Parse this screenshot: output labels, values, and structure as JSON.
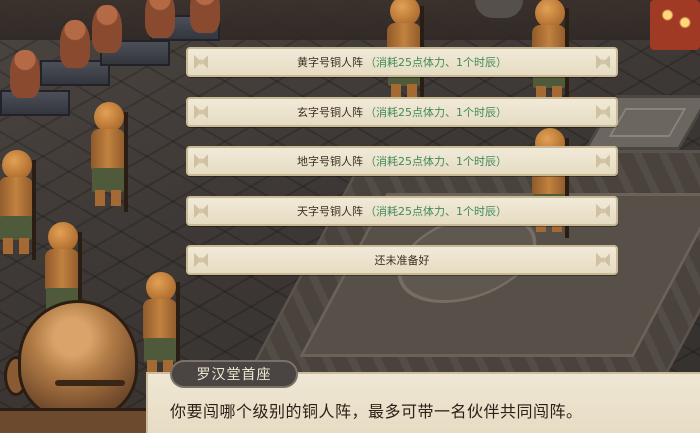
{
  "menu": {
    "options": [
      {
        "name": "黄字号铜人阵",
        "cost": "（消耗25点体力、1个时辰）"
      },
      {
        "name": "玄字号铜人阵",
        "cost": "（消耗25点体力、1个时辰）"
      },
      {
        "name": "地字号铜人阵",
        "cost": "（消耗25点体力、1个时辰）"
      },
      {
        "name": "天字号铜人阵",
        "cost": "（消耗25点体力、1个时辰）"
      },
      {
        "name": "还未准备好",
        "cost": ""
      }
    ]
  },
  "dialogue": {
    "speaker": "罗汉堂首座",
    "text": "你要闯哪个级别的铜人阵，最多可带一名伙伴共同闯阵。"
  },
  "colors": {
    "option_bg": "#ede5d0",
    "cost_text": "#3f8a5a",
    "dialog_bg": "#ece3cf",
    "nameplate_bg": "#4a4542"
  }
}
